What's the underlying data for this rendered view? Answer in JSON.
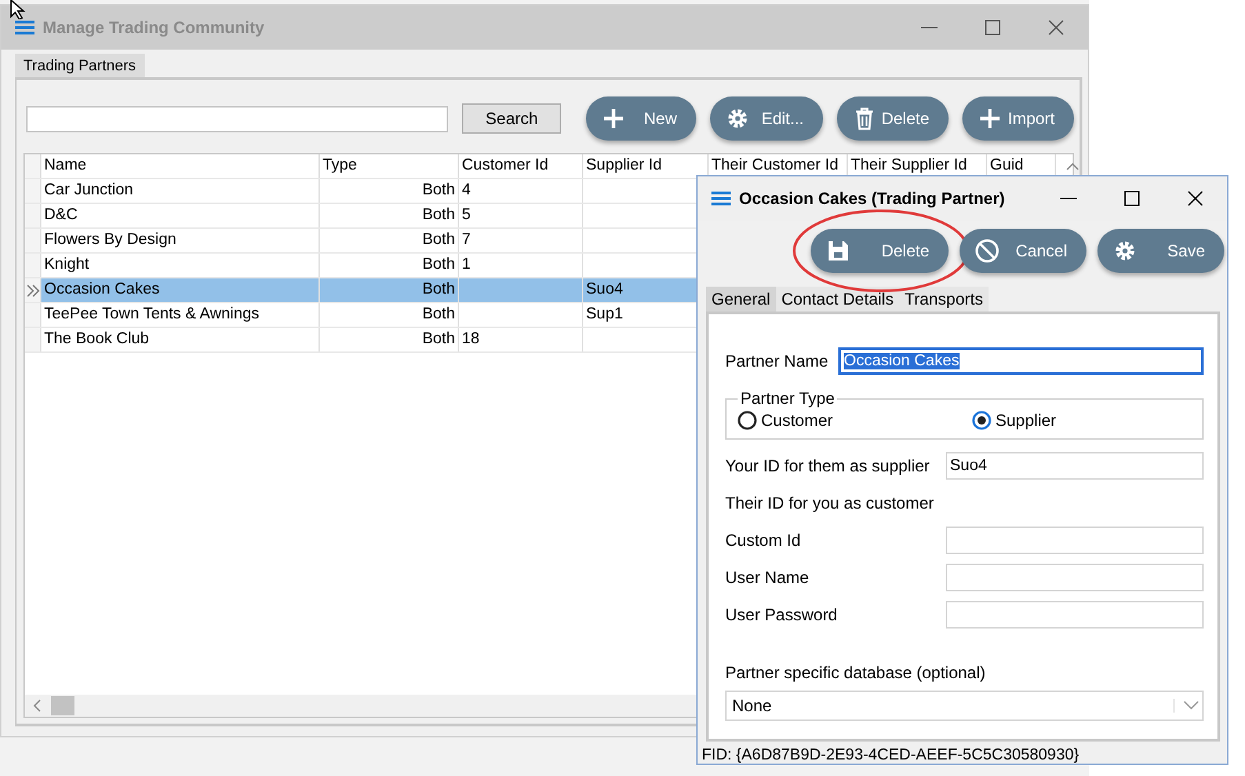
{
  "main_window": {
    "title": "Manage Trading Community",
    "tabs": [
      {
        "label": "Trading Partners",
        "selected": true
      }
    ],
    "search": {
      "button": "Search"
    },
    "actions": [
      {
        "label": "New"
      },
      {
        "label": "Edit..."
      },
      {
        "label": "Delete"
      },
      {
        "label": "Import"
      }
    ],
    "table": {
      "columns": [
        "Name",
        "Type",
        "Customer Id",
        "Supplier Id",
        "Their Customer Id",
        "Their Supplier Id",
        "Guid"
      ],
      "rows": [
        {
          "name": "Car Junction",
          "type": "Both",
          "customer_id": "4",
          "selected": false
        },
        {
          "name": "D&C",
          "type": "Both",
          "customer_id": "5",
          "selected": false
        },
        {
          "name": "Flowers By Design",
          "type": "Both",
          "customer_id": "7",
          "selected": false
        },
        {
          "name": "Knight",
          "type": "Both",
          "customer_id": "1",
          "selected": false
        },
        {
          "name": "Occasion Cakes",
          "type": "Both",
          "supplier_id": "Suo4",
          "selected": true
        },
        {
          "name": "TeePee Town Tents & Awnings",
          "type": "Both",
          "supplier_id": "Sup1",
          "selected": false
        },
        {
          "name": "The Book Club",
          "type": "Both",
          "customer_id": "18",
          "selected": false
        }
      ]
    }
  },
  "dialog": {
    "title": "Occasion Cakes (Trading Partner)",
    "actions": [
      {
        "label": "Delete",
        "circled": true
      },
      {
        "label": "Cancel",
        "circled": false
      },
      {
        "label": "Save",
        "circled": false
      }
    ],
    "tabs": [
      {
        "label": "General",
        "selected": true
      },
      {
        "label": "Contact Details",
        "selected": false
      },
      {
        "label": "Transports",
        "selected": false
      }
    ],
    "partner_name": {
      "label": "Partner Name",
      "value": "Occasion Cakes",
      "text_selected": true
    },
    "partner_type": {
      "legend": "Partner Type",
      "options": [
        {
          "label": "Customer",
          "selected": false
        },
        {
          "label": "Supplier",
          "selected": true
        }
      ]
    },
    "fields": [
      {
        "kind": "input",
        "label": "Your ID for them as supplier",
        "value": "Suo4"
      },
      {
        "kind": "heading",
        "label": "Their ID for you as customer"
      },
      {
        "kind": "input",
        "label": "Custom Id"
      },
      {
        "kind": "input",
        "label": "User Name"
      },
      {
        "kind": "input",
        "label": "User Password"
      }
    ],
    "database": {
      "label": "Partner specific database (optional)",
      "value": "None"
    },
    "fid": "FID: {A6D87B9D-2E93-4CED-AEEF-5C5C30580930}"
  }
}
